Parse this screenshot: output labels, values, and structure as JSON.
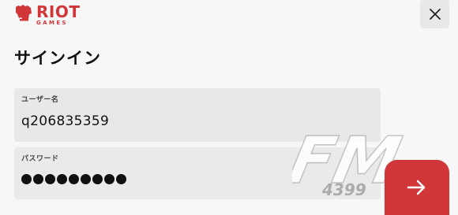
{
  "logo": {
    "main_text": "RIOT",
    "sub_text": "GAMES",
    "icon": "riot-fist-icon",
    "color": "#d13639"
  },
  "close_button": {
    "icon": "close-icon"
  },
  "page": {
    "title": "サインイン"
  },
  "username_field": {
    "label": "ユーザー名",
    "value": "q206835359"
  },
  "password_field": {
    "label": "パスワード",
    "masked_length": 9
  },
  "submit_button": {
    "icon": "arrow-right-icon",
    "color": "#d13639"
  },
  "watermark": {
    "main_text": "FM",
    "sub_text": "4399"
  }
}
